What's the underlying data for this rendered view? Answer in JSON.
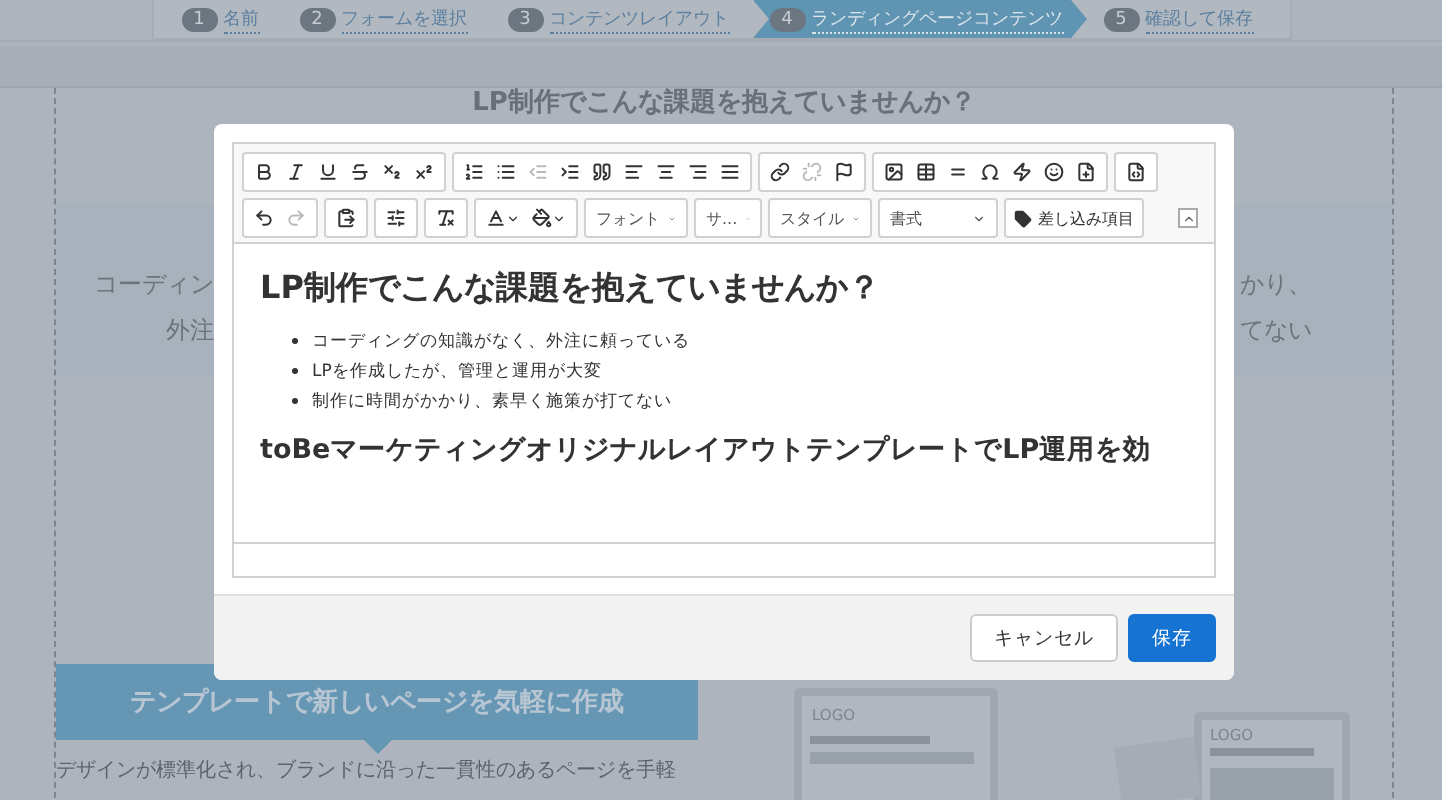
{
  "stepper": [
    {
      "number": "1",
      "label": "名前",
      "selected": false
    },
    {
      "number": "2",
      "label": "フォームを選択",
      "selected": false
    },
    {
      "number": "3",
      "label": "コンテンツレイアウト",
      "selected": false
    },
    {
      "number": "4",
      "label": "ランディングページコンテンツ",
      "selected": true
    },
    {
      "number": "5",
      "label": "確認して保存",
      "selected": false
    }
  ],
  "page": {
    "heading": "LP制作でこんな課題を抱えていませんか？",
    "problem_box": {
      "left_lines": [
        "コーディン",
        "外注"
      ],
      "right_lines": [
        "かり、",
        "てない"
      ]
    },
    "banner": "テンプレートで新しいページを気軽に作成",
    "body_text": "デザインが標準化され、ブランドに沿った一貫性のあるページを手軽",
    "mockups": [
      {
        "logo": "LOGO"
      },
      {
        "logo": "LOGO"
      }
    ]
  },
  "dialog": {
    "toolbar_row_1": [
      [
        {
          "kind": "bold",
          "disabled": false
        },
        {
          "kind": "italic",
          "disabled": false
        },
        {
          "kind": "underline",
          "disabled": false
        },
        {
          "kind": "strike",
          "disabled": false
        },
        {
          "kind": "subscript",
          "disabled": false
        },
        {
          "kind": "superscript",
          "disabled": false
        }
      ],
      [
        {
          "kind": "ordered-list",
          "disabled": false
        },
        {
          "kind": "bullet-list",
          "disabled": false
        },
        {
          "kind": "outdent",
          "disabled": true
        },
        {
          "kind": "indent",
          "disabled": false
        },
        {
          "kind": "quote",
          "disabled": false
        },
        {
          "kind": "align-left",
          "disabled": false
        },
        {
          "kind": "align-center",
          "disabled": false
        },
        {
          "kind": "align-right",
          "disabled": false
        },
        {
          "kind": "justify",
          "disabled": false
        }
      ],
      [
        {
          "kind": "link",
          "disabled": false
        },
        {
          "kind": "unlink",
          "disabled": true
        },
        {
          "kind": "flag",
          "disabled": false
        }
      ],
      [
        {
          "kind": "image",
          "disabled": false
        },
        {
          "kind": "table",
          "disabled": false
        },
        {
          "kind": "rule",
          "disabled": false
        },
        {
          "kind": "omega",
          "disabled": false
        },
        {
          "kind": "flash",
          "disabled": false
        },
        {
          "kind": "smiley",
          "disabled": false
        },
        {
          "kind": "template",
          "disabled": false
        }
      ],
      [
        {
          "kind": "source",
          "disabled": false
        }
      ]
    ],
    "toolbar_row_2": [
      [
        {
          "kind": "undo",
          "disabled": false
        },
        {
          "kind": "redo",
          "disabled": true
        }
      ],
      [
        {
          "kind": "paste",
          "disabled": false
        }
      ],
      [
        {
          "kind": "sliders",
          "disabled": false
        }
      ],
      [
        {
          "kind": "clear-format",
          "disabled": false
        }
      ],
      [
        {
          "kind": "text-color",
          "disabled": false
        },
        {
          "kind": "bg-color",
          "disabled": false
        }
      ]
    ],
    "dropdowns": [
      "フォント",
      "サ...",
      "スタイル",
      "書式"
    ],
    "merge_button": "差し込み項目",
    "content": {
      "heading": "LP制作でこんな課題を抱えていませんか？",
      "items": [
        "コーディングの知識がなく、外注に頼っている",
        "LPを作成したが、管理と運用が大変",
        "制作に時間がかかり、素早く施策が打てない"
      ],
      "subheading": "toBeマーケティングオリジナルレイアウトテンプレートでLP運用を効"
    },
    "buttons": [
      {
        "label": "キャンセル",
        "kind": "secondary"
      },
      {
        "label": "保存",
        "kind": "primary"
      }
    ]
  }
}
